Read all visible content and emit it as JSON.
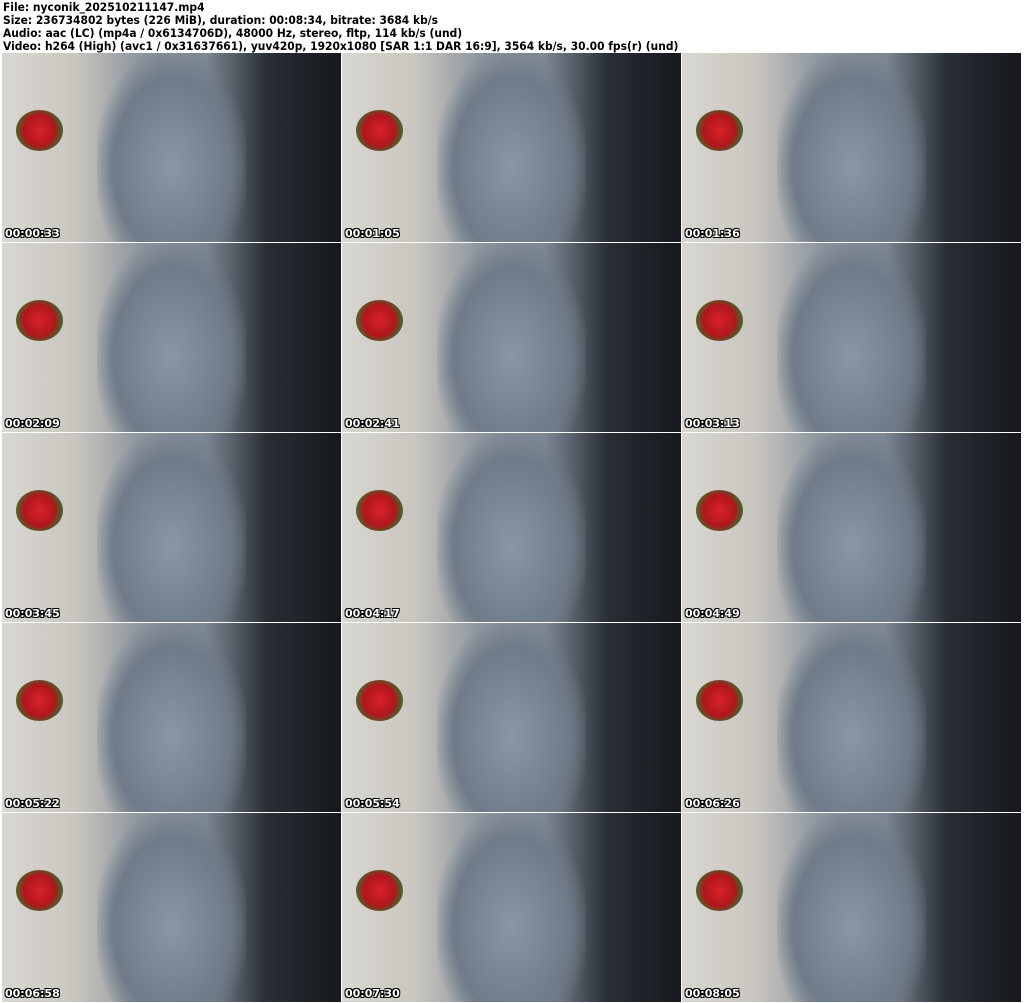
{
  "header": {
    "file": "File: nyconik_202510211147.mp4",
    "size": "Size: 236734802 bytes (226 MiB), duration: 00:08:34, bitrate: 3684 kb/s",
    "audio": "Audio: aac (LC) (mp4a / 0x6134706D), 48000 Hz, stereo, fltp, 114 kb/s (und)",
    "video": "Video: h264 (High) (avc1 / 0x31637661), yuv420p, 1920x1080 [SAR 1:1 DAR 16:9], 3564 kb/s, 30.00 fps(r) (und)"
  },
  "thumbnails": [
    {
      "timestamp": "00:00:33"
    },
    {
      "timestamp": "00:01:05"
    },
    {
      "timestamp": "00:01:36"
    },
    {
      "timestamp": "00:02:09"
    },
    {
      "timestamp": "00:02:41"
    },
    {
      "timestamp": "00:03:13"
    },
    {
      "timestamp": "00:03:45"
    },
    {
      "timestamp": "00:04:17"
    },
    {
      "timestamp": "00:04:49"
    },
    {
      "timestamp": "00:05:22"
    },
    {
      "timestamp": "00:05:54"
    },
    {
      "timestamp": "00:06:26"
    },
    {
      "timestamp": "00:06:58"
    },
    {
      "timestamp": "00:07:30"
    },
    {
      "timestamp": "00:08:05"
    }
  ]
}
